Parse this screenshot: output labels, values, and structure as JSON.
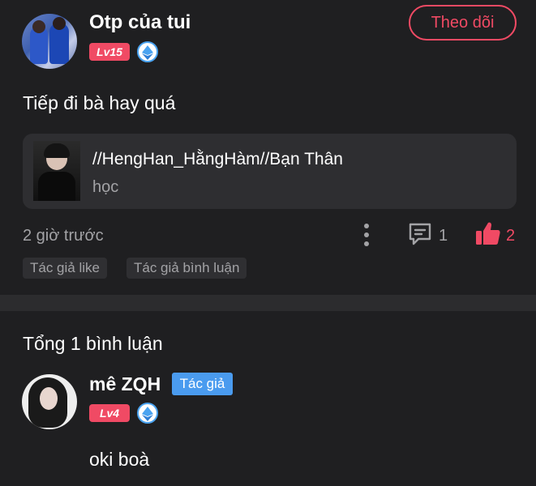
{
  "post": {
    "username": "Otp của tui",
    "level": "Lv15",
    "follow_label": "Theo dõi",
    "text": "Tiếp đi bà hay quá",
    "quote": {
      "title": "//HengHan_HằngHàm//Bạn Thân",
      "subtitle": "học"
    },
    "time": "2 giờ trước",
    "comment_count": "1",
    "like_count": "2",
    "tags": [
      "Tác giả like",
      "Tác giả bình luận"
    ]
  },
  "comments_section": {
    "total_label": "Tổng 1 bình luận",
    "items": [
      {
        "name": "mê ZQH",
        "author_badge": "Tác giả",
        "level": "Lv4",
        "text": "oki boà"
      }
    ]
  },
  "colors": {
    "background": "#1f1f21",
    "accent_pink": "#f04a64",
    "author_blue": "#4a9bef",
    "muted_text": "#a3a3a6"
  },
  "icons": [
    "more-vertical-icon",
    "comment-icon",
    "thumbs-up-icon",
    "ethereum-badge-icon"
  ]
}
